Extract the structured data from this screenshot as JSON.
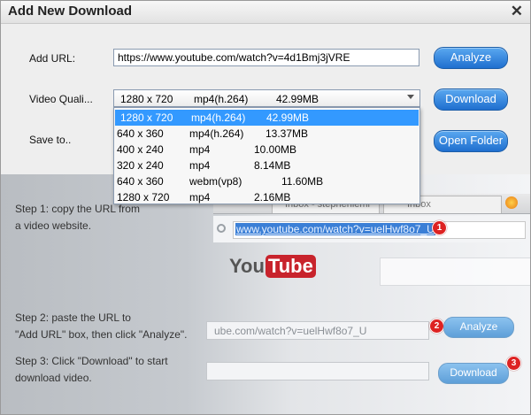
{
  "window": {
    "title": "Add New Download"
  },
  "form": {
    "url_label": "Add URL:",
    "url_value": "https://www.youtube.com/watch?v=4d1Bmj3jVRE",
    "quality_label": "Video Quali...",
    "save_label": "Save to.."
  },
  "buttons": {
    "analyze": "Analyze",
    "download": "Download",
    "open_folder": "Open Folder"
  },
  "quality": {
    "selected": {
      "res": "1280 x 720",
      "codec": "mp4(h.264)",
      "size": "42.99MB"
    },
    "options": [
      {
        "res": "1280 x 720",
        "codec": "mp4(h.264)",
        "size": "42.99MB"
      },
      {
        "res": "640 x 360",
        "codec": "mp4(h.264)",
        "size": "13.37MB"
      },
      {
        "res": "400 x 240",
        "codec": "mp4",
        "size": "10.00MB"
      },
      {
        "res": "320 x 240",
        "codec": "mp4",
        "size": "8.14MB"
      },
      {
        "res": "640 x 360",
        "codec": "webm(vp8)",
        "size": "11.60MB"
      },
      {
        "res": "1280 x 720",
        "codec": "mp4",
        "size": "2.16MB"
      }
    ]
  },
  "steps": {
    "step1_line1": "Step 1: copy the URL from",
    "step1_line2": "a video website.",
    "step2_line1": "Step 2: paste the URL to",
    "step2_line2": "\"Add URL\" box, then click \"Analyze\".",
    "step3_line1": "Step 3: Click \"Download\" to start",
    "step3_line2": "download video."
  },
  "illustration": {
    "address_url": "www.youtube.com/watch?v=uelHwf8o7_U",
    "tab1": "Inbox - stephenleml",
    "tab2": "Inbox",
    "logo_you": "You",
    "logo_tube": "Tube",
    "paste_url": "ube.com/watch?v=uelHwf8o7_U",
    "analyze_label": "Analyze",
    "download_label": "Download",
    "badge1": "1",
    "badge2": "2",
    "badge3": "3"
  },
  "colors": {
    "accent": "#1f6fcf",
    "selection": "#3399ff",
    "badge": "#dd2222"
  }
}
